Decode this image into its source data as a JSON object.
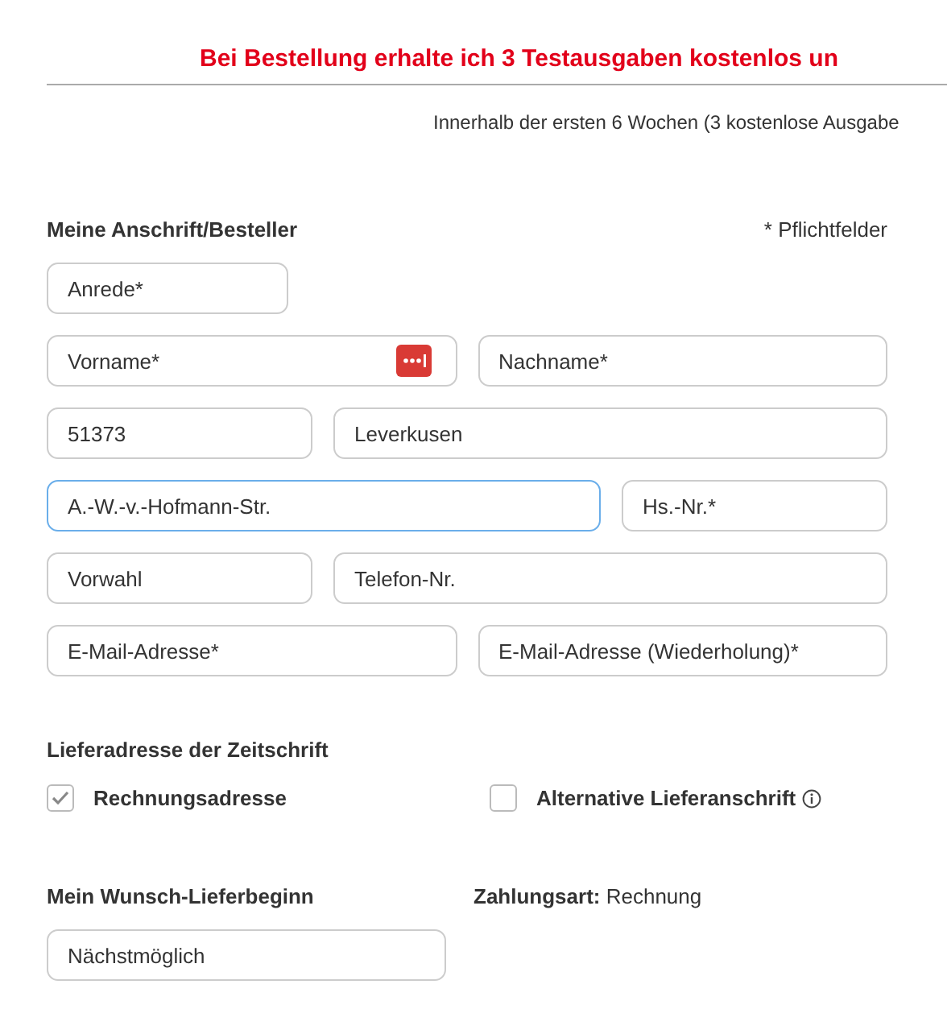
{
  "header": {
    "title": "Bei Bestellung erhalte ich 3 Testausgaben kostenlos un",
    "subtitle": "Innerhalb der ersten 6 Wochen (3 kostenlose Ausgabe"
  },
  "address": {
    "title": "Meine Anschrift/Besteller",
    "required_note": "* Pflichtfelder",
    "rows": [
      [
        {
          "placeholder": "Anrede*",
          "focused": false
        }
      ],
      [
        {
          "placeholder": "Vorname*",
          "focused": false,
          "password_manager": true
        },
        {
          "placeholder": "Nachname*",
          "focused": false
        }
      ],
      [
        {
          "value": "51373",
          "focused": false
        },
        {
          "value": "Leverkusen",
          "focused": false
        }
      ],
      [
        {
          "value": "A.-W.-v.-Hofmann-Str.",
          "focused": true
        },
        {
          "placeholder": "Hs.-Nr.*",
          "focused": false
        }
      ],
      [
        {
          "placeholder": "Vorwahl",
          "focused": false
        },
        {
          "placeholder": "Telefon-Nr.",
          "focused": false
        }
      ],
      [
        {
          "placeholder": "E-Mail-Adresse*",
          "focused": false
        },
        {
          "placeholder": "E-Mail-Adresse (Wiederholung)*",
          "focused": false
        }
      ]
    ]
  },
  "delivery": {
    "title": "Lieferadresse der Zeitschrift",
    "options": [
      {
        "label": "Rechnungsadresse",
        "checked": true,
        "info": false
      },
      {
        "label": "Alternative Lieferanschrift",
        "checked": false,
        "info": true
      }
    ]
  },
  "start": {
    "title": "Mein Wunsch-Lieferbeginn",
    "value": "Nächstmöglich"
  },
  "payment": {
    "text": "**Zahlungsart:** Rechnung"
  }
}
